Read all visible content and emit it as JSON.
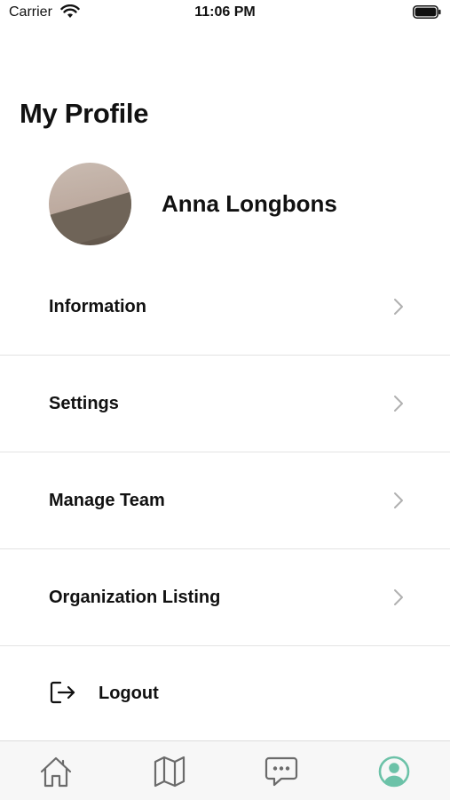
{
  "status_bar": {
    "carrier": "Carrier",
    "time": "11:06 PM"
  },
  "page": {
    "title": "My Profile"
  },
  "profile": {
    "name": "Anna Longbons"
  },
  "menu": {
    "items": [
      {
        "label": "Information",
        "icon": "chevron-right-icon"
      },
      {
        "label": "Settings",
        "icon": "chevron-right-icon"
      },
      {
        "label": "Manage Team",
        "icon": "chevron-right-icon"
      },
      {
        "label": "Organization Listing",
        "icon": "chevron-right-icon"
      }
    ],
    "logout": {
      "label": "Logout",
      "icon": "logout-icon"
    }
  },
  "tab_bar": {
    "tabs": [
      {
        "icon": "home-icon",
        "active": false
      },
      {
        "icon": "map-icon",
        "active": false
      },
      {
        "icon": "chat-icon",
        "active": false
      },
      {
        "icon": "profile-icon",
        "active": true
      }
    ]
  },
  "colors": {
    "accent": "#6cc2a8",
    "icon_inactive": "#6b6b6b",
    "divider": "#e3e3e3",
    "text": "#111111"
  }
}
